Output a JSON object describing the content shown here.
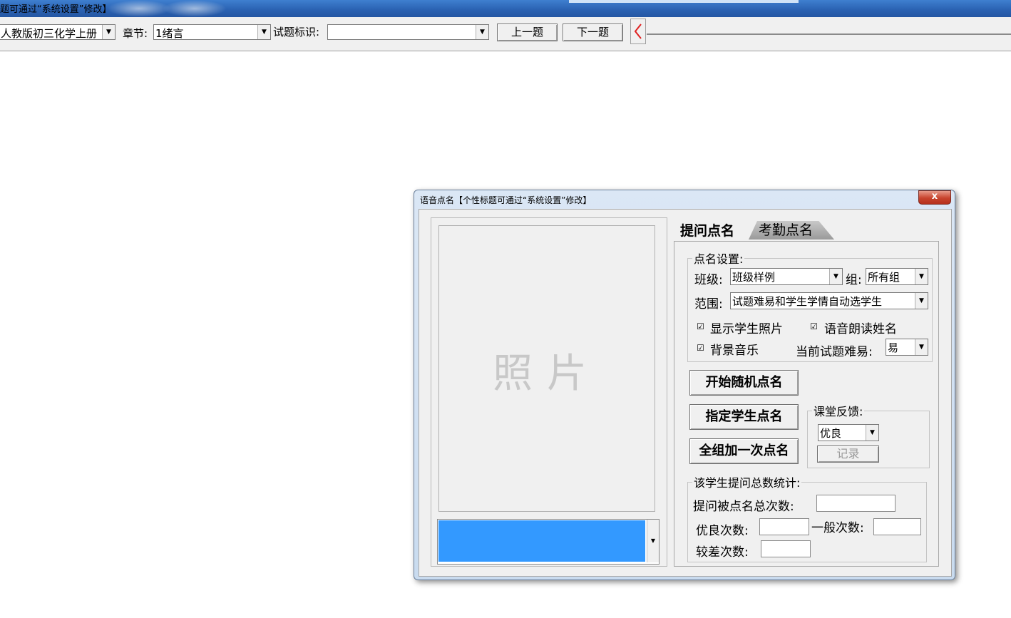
{
  "top": {
    "title": "题可通过“系统设置”修改】"
  },
  "toolbar": {
    "textbook": "人教版初三化学上册",
    "chapter_label": "章节:",
    "chapter_value": "1绪言",
    "question_id_label": "试题标识:",
    "question_id_value": "",
    "prev_button": "上一题",
    "next_button": "下一题"
  },
  "dialog": {
    "title": "语音点名【个性标题可通过“系统设置”修改】",
    "close": "x",
    "photo_placeholder": "照片",
    "tabs": [
      {
        "label": "提问点名",
        "active": true
      },
      {
        "label": "考勤点名",
        "active": false
      }
    ],
    "settings": {
      "legend": "点名设置:",
      "class_label": "班级:",
      "class_value": "班级样例",
      "group_label": "组:",
      "group_value": "所有组",
      "range_label": "范围:",
      "range_value": "试题难易和学生学情自动选学生",
      "show_photo": {
        "label": "显示学生照片",
        "checked": true
      },
      "voice_read": {
        "label": "语音朗读姓名",
        "checked": true
      },
      "bg_music": {
        "label": "背景音乐",
        "checked": true
      },
      "difficulty_label": "当前试题难易:",
      "difficulty_value": "易"
    },
    "buttons": {
      "random": "开始随机点名",
      "designate": "指定学生点名",
      "group_once": "全组加一次点名"
    },
    "feedback": {
      "legend": "课堂反馈:",
      "value": "优良",
      "record_button": "记录"
    },
    "stats": {
      "legend": "该学生提问总数统计:",
      "total_label": "提问被点名总次数:",
      "good_label": "优良次数:",
      "normal_label": "一般次数:",
      "poor_label": "较差次数:",
      "total_value": "",
      "good_value": "",
      "normal_value": "",
      "poor_value": ""
    }
  }
}
